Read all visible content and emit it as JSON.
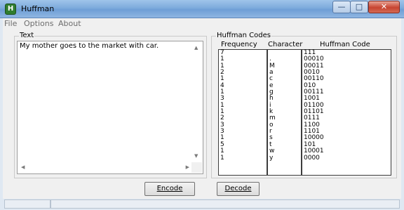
{
  "window": {
    "title": "Huffman",
    "icon": "app-icon",
    "controls": {
      "minimize": "—",
      "maximize": "□",
      "close": "✕"
    }
  },
  "menu": [
    "File",
    "Options",
    "About"
  ],
  "text_group": {
    "label": "Text",
    "content": "My mother goes to the market with car."
  },
  "codes_group": {
    "label": "Huffman Codes",
    "headers": [
      "Frequency",
      "Character",
      "Huffman Code"
    ]
  },
  "codes": [
    {
      "freq": "7",
      "char": " ",
      "code": "111"
    },
    {
      "freq": "1",
      "char": ".",
      "code": "00010"
    },
    {
      "freq": "1",
      "char": "M",
      "code": "00011"
    },
    {
      "freq": "2",
      "char": "a",
      "code": "0010"
    },
    {
      "freq": "1",
      "char": "c",
      "code": "00110"
    },
    {
      "freq": "4",
      "char": "e",
      "code": "010"
    },
    {
      "freq": "1",
      "char": "g",
      "code": "00111"
    },
    {
      "freq": "3",
      "char": "h",
      "code": "1001"
    },
    {
      "freq": "1",
      "char": "i",
      "code": "01100"
    },
    {
      "freq": "1",
      "char": "k",
      "code": "01101"
    },
    {
      "freq": "2",
      "char": "m",
      "code": "0111"
    },
    {
      "freq": "3",
      "char": "o",
      "code": "1100"
    },
    {
      "freq": "3",
      "char": "r",
      "code": "1101"
    },
    {
      "freq": "1",
      "char": "s",
      "code": "10000"
    },
    {
      "freq": "5",
      "char": "t",
      "code": "101"
    },
    {
      "freq": "1",
      "char": "w",
      "code": "10001"
    },
    {
      "freq": "1",
      "char": "y",
      "code": "0000"
    }
  ],
  "buttons": {
    "encode": "Encode",
    "decode": "Decode"
  }
}
